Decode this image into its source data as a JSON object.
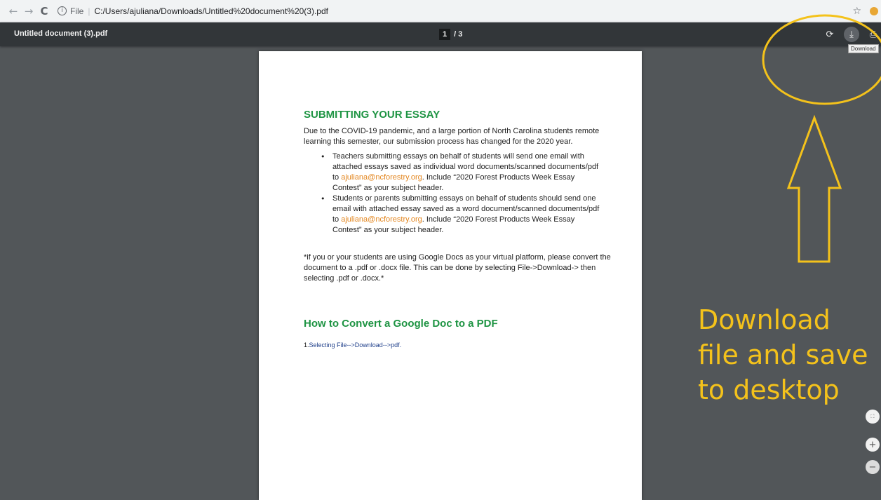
{
  "browser": {
    "back_icon": "←",
    "forward_icon": "→",
    "reload_icon": "C",
    "info_icon": "i",
    "scheme_label": "File",
    "url": "C:/Users/ajuliana/Downloads/Untitled%20document%20(3).pdf",
    "star_icon": "☆"
  },
  "pdf_toolbar": {
    "title": "Untitled document (3).pdf",
    "current_page": "1",
    "page_sep": "/ 3",
    "rotate_icon": "⟳",
    "download_icon": "⤓",
    "print_icon": "⎙",
    "tooltip": "Download"
  },
  "document": {
    "heading1": "SUBMITTING YOUR ESSAY",
    "intro": "Due to the COVID-19 pandemic, and a large portion of North Carolina students remote learning this semester, our submission process has changed for the 2020 year.",
    "bullet1_pre": "Teachers submitting essays on behalf of students will send one email with attached essays saved as individual word documents/scanned documents/pdf to ",
    "bullet1_email": "ajuliana@ncforestry.org",
    "bullet1_post": ". Include “2020 Forest Products Week Essay Contest” as your subject header.",
    "bullet2_pre": "Students or parents submitting essays on behalf of students should send one email with attached essay saved as a word document/scanned documents/pdf to ",
    "bullet2_email": "ajuliana@ncforestry.org",
    "bullet2_post": ". Include “2020 Forest Products Week Essay Contest” as your subject header.",
    "note": "*if you or your students are using Google Docs as your virtual platform, please convert the document to a .pdf or .docx file. This can be done by selecting File->Download-> then selecting .pdf or .docx.*",
    "heading2": "How to Convert a Google Doc to a PDF",
    "step_num": "1.",
    "step_text": "Selecting File-->Download-->pdf."
  },
  "annotation": {
    "text": "Download file and save to desktop",
    "color": "#f4c21b"
  },
  "zoom": {
    "fit_icon": "⛶",
    "in_icon": "+",
    "out_icon": "−"
  }
}
